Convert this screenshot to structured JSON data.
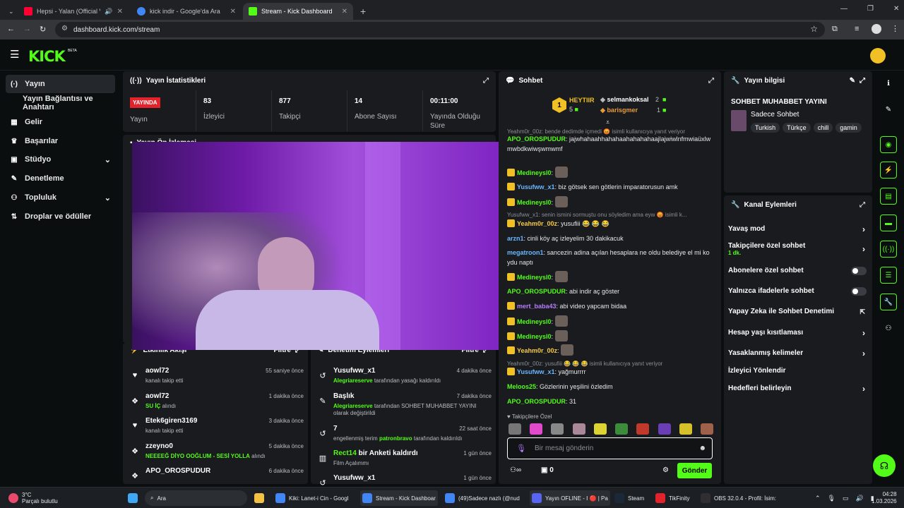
{
  "browser": {
    "tabs": [
      {
        "title": "Hepsi - Yalan (Official Video)",
        "color": "#ff0033"
      },
      {
        "title": "kick indir - Google'da Ara",
        "color": "#4285f4"
      },
      {
        "title": "Stream - Kick Dashboard",
        "color": "#53fc18"
      }
    ],
    "url": "dashboard.kick.com/stream"
  },
  "header": {
    "logo": "KICK",
    "beta": "BETA"
  },
  "sidebar": {
    "items": [
      {
        "label": "Yayın",
        "icon": "(·)"
      },
      {
        "label": "Yayın Bağlantısı ve Anahtarı",
        "icon": ""
      },
      {
        "label": "Gelir",
        "icon": "▦"
      },
      {
        "label": "Başarılar",
        "icon": "🏆"
      },
      {
        "label": "Stüdyo",
        "icon": "▣"
      },
      {
        "label": "Denetleme",
        "icon": "🔧"
      },
      {
        "label": "Topluluk",
        "icon": "👥"
      },
      {
        "label": "Droplar ve ödüller",
        "icon": "⇅"
      }
    ]
  },
  "stats": {
    "title": "Yayın İstatistikleri",
    "live_badge": "YAYINDA",
    "live_label": "Yayın",
    "items": [
      {
        "value": "83",
        "label": "İzleyici"
      },
      {
        "value": "877",
        "label": "Takipçi"
      },
      {
        "value": "14",
        "label": "Abone Sayısı"
      },
      {
        "value": "00:11:00",
        "label": "Yayında Olduğu Süre"
      }
    ]
  },
  "preview": {
    "title": "Yayın Ön İzlemesi"
  },
  "activity": {
    "title": "Etkinlik Akışı",
    "filter": "Filtre",
    "rows": [
      {
        "name": "aowl72",
        "sub": "kanalı takip etti",
        "highlight": "",
        "time": "55 saniye önce",
        "icon": "♥"
      },
      {
        "name": "aowl72",
        "sub": "alındı",
        "highlight": "SU İÇ",
        "time": "1 dakika önce",
        "icon": "❖"
      },
      {
        "name": "Etek6giren3169",
        "sub": "kanalı takip etti",
        "highlight": "",
        "time": "3 dakika önce",
        "icon": "♥"
      },
      {
        "name": "zzeyno0",
        "sub": "alındı",
        "highlight": "NEEEEĞ DİYO OOĞLUM - SESİ YOLLA",
        "time": "5 dakika önce",
        "icon": "❖"
      },
      {
        "name": "APO_OROSPUDUR",
        "sub": "",
        "highlight": "",
        "time": "6 dakika önce",
        "icon": "❖"
      }
    ]
  },
  "modlog": {
    "title": "Denetim Eylemleri",
    "filter": "Filtre",
    "rows": [
      {
        "name": "Yusufww_x1",
        "who": "Alegriareserve",
        "sub": "tarafından yasağı kaldırıldı",
        "time": "4 dakika önce",
        "icon": "↺"
      },
      {
        "name": "Başlık",
        "who": "Alegriareserve",
        "sub": "tarafından SOHBET MUHABBET YAYINI olarak değiştirildi",
        "time": "7 dakika önce",
        "icon": "✎"
      },
      {
        "name": "7",
        "who": "patronbravo",
        "sub_pre": "engellenmiş terim",
        "sub": "tarafından kaldırıldı",
        "time": "22 saat önce",
        "icon": "↺"
      },
      {
        "name": "Rect14",
        "who": "",
        "sub": "Film Açalımmı",
        "name_suffix": "bir Anketi kaldırdı",
        "time": "1 gün önce",
        "icon": "▥"
      },
      {
        "name": "Yusufww_x1",
        "who": "",
        "sub": "",
        "time": "1 gün önce",
        "icon": "↺"
      }
    ]
  },
  "chat": {
    "title": "Sohbet",
    "leaderboard": {
      "top_name": "HEYTIIR",
      "top_rank": "1",
      "top_count": "5",
      "others": [
        {
          "name": "selmankoksal",
          "count": "2"
        },
        {
          "name": "barisgmer",
          "count": "1"
        }
      ]
    },
    "messages": [
      {
        "type": "sys",
        "text": "Yeahm0r_00z: bende dedimde içmedi 😡 isimli kullanıcıya yanıt veriyor"
      },
      {
        "user": "APO_OROSPUDUR",
        "color": "#53fc18",
        "text": "jajwhahaahhahahaahahahahaajlajwiwlnfmwiaüxlwmwbdkwiwşwmwmf"
      },
      {
        "user": "Medineysl0",
        "color": "#53fc18",
        "text": "",
        "emote": true,
        "badge": true
      },
      {
        "user": "Yusufww_x1",
        "color": "#6ab7ff",
        "text": "biz götsek sen götlerin imparatorusun amk",
        "badge": true
      },
      {
        "user": "Medineysl0",
        "color": "#53fc18",
        "text": "",
        "emote": true,
        "badge": true
      },
      {
        "type": "sys",
        "text": "Yusufww_x1: senin ismini sormuştu onu söyledim ama eyw 😡 isimli k..."
      },
      {
        "user": "Yeahm0r_00z",
        "color": "#f7c948",
        "text": "yusufiii 😂 😂 😂",
        "badge": true
      },
      {
        "user": "arzn1",
        "color": "#6ab7ff",
        "text": "cinli köy aç izleyelim 30 dakikacuk"
      },
      {
        "user": "megatroon1",
        "color": "#6ab7ff",
        "text": "sancezin adina açılan hesaplara ne oldu belediye el mi koydu naptı"
      },
      {
        "user": "Medineysl0",
        "color": "#53fc18",
        "text": "",
        "emote": true,
        "badge": true
      },
      {
        "user": "APO_OROSPUDUR",
        "color": "#53fc18",
        "text": "abi indir aç göster"
      },
      {
        "user": "mert_baba43",
        "color": "#b57cff",
        "text": "abi video yapcam bidaa",
        "badge": true
      },
      {
        "user": "Medineysl0",
        "color": "#53fc18",
        "text": "",
        "emote": true,
        "badge": true
      },
      {
        "user": "Medineysl0",
        "color": "#53fc18",
        "text": "",
        "emote": true,
        "badge": true
      },
      {
        "user": "Yeahm0r_00z",
        "color": "#f7c948",
        "text": "",
        "emote": true,
        "badge": true
      },
      {
        "type": "sys",
        "text": "Yeahm0r_00z: yusufiii 😂 😂 😂 isimli kullanıcıya yanıt veriyor"
      },
      {
        "user": "Yusufww_x1",
        "color": "#6ab7ff",
        "text": "yağmurrrr",
        "badge": true
      },
      {
        "user": "Meloos25",
        "color": "#53fc18",
        "text": "Gözlerinin yeşilini özledim"
      },
      {
        "user": "APO_OROSPUDUR",
        "color": "#53fc18",
        "text": "31"
      }
    ],
    "followers_only": "Takipçilere Özel",
    "input_placeholder": "Bir mesaj gönderin",
    "points": "0",
    "send": "Gönder"
  },
  "streaminfo": {
    "title": "Yayın bilgisi",
    "stream_title": "SOHBET MUHABBET YAYINI",
    "category": "Sadece Sohbet",
    "tags": [
      "Turkish",
      "Türkçe",
      "chill",
      "gamin"
    ]
  },
  "channel_actions": {
    "title": "Kanal Eylemleri",
    "items": [
      {
        "label": "Yavaş mod",
        "kind": "chev"
      },
      {
        "label": "Takipçilere özel sohbet",
        "sub": "1 dk.",
        "kind": "chev"
      },
      {
        "label": "Abonelere özel sohbet",
        "kind": "toggle"
      },
      {
        "label": "Yalnızca ifadelerle sohbet",
        "kind": "toggle"
      },
      {
        "label": "Yapay Zeka ile Sohbet Denetimi",
        "kind": "ext"
      },
      {
        "label": "Hesap yaşı kısıtlaması",
        "kind": "chev"
      },
      {
        "label": "Yasaklanmış kelimeler",
        "kind": "chev"
      },
      {
        "label": "İzleyici Yönlendir",
        "kind": "none"
      },
      {
        "label": "Hedefleri belirleyin",
        "kind": "chev"
      }
    ]
  },
  "taskbar": {
    "weather_temp": "3°C",
    "weather_desc": "Parçalı bulutlu",
    "search": "Ara",
    "apps": [
      {
        "label": "Kiki: Lanet-i Cin - Googl",
        "color": "#4285f4"
      },
      {
        "label": "Stream - Kick Dashboar",
        "color": "#4285f4"
      },
      {
        "label": "(49)Sadece nazlı (@nud",
        "color": "#4285f4"
      },
      {
        "label": "Yayın OFLINE - I 🔴 | Pa",
        "color": "#5865f2"
      },
      {
        "label": "Steam",
        "color": "#1b2838"
      },
      {
        "label": "TikFinity",
        "color": "#e3232c"
      },
      {
        "label": "OBS 32.0.4 - Profil: İsim:",
        "color": "#302e31"
      }
    ],
    "time": "04:28",
    "date": "1.03.2026"
  }
}
